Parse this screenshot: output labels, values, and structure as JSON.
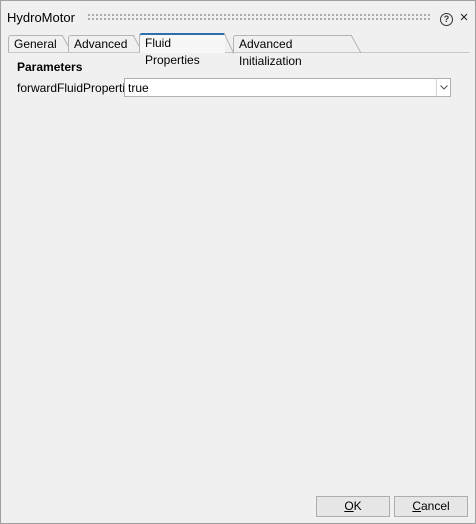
{
  "window": {
    "title": "HydroMotor",
    "help_icon": "?",
    "close_icon": "×"
  },
  "tabs": [
    {
      "label": "General",
      "active": false
    },
    {
      "label": "Advanced",
      "active": false
    },
    {
      "label": "Fluid Properties",
      "active": true
    },
    {
      "label": "Advanced Initialization",
      "active": false
    }
  ],
  "parameters": {
    "section_title": "Parameters",
    "items": [
      {
        "label": "forwardFluidProperties",
        "value": "true"
      }
    ]
  },
  "buttons": {
    "ok_mnemonic": "O",
    "ok_rest": "K",
    "cancel_mnemonic": "C",
    "cancel_rest": "ancel"
  },
  "colors": {
    "active_tab_accent": "#2d6fa8",
    "background": "#f0f0f0"
  },
  "icons": {
    "help": "question-circle-icon",
    "close": "close-icon",
    "dropdown": "chevron-down-icon"
  }
}
